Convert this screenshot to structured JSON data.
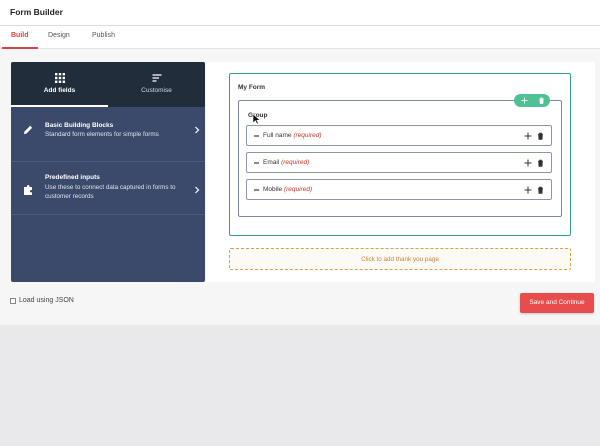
{
  "app": {
    "title": "Form Builder"
  },
  "tabs": [
    {
      "label": "Build",
      "active": true
    },
    {
      "label": "Design",
      "active": false
    },
    {
      "label": "Publish",
      "active": false
    }
  ],
  "sidebar": {
    "tabs": [
      {
        "label": "Add fields",
        "icon": "grid-icon",
        "active": true
      },
      {
        "label": "Customise",
        "icon": "sliders-icon",
        "active": false
      }
    ],
    "items": [
      {
        "title": "Basic Building Blocks",
        "description": "Standard form elements for simple forms",
        "icon": "pencil-icon"
      },
      {
        "title": "Predefined inputs",
        "description": "Use these to connect data captured in forms to customer records",
        "icon": "puzzle-icon"
      }
    ]
  },
  "form": {
    "title": "My Form",
    "group": {
      "title": "Group",
      "fields": [
        {
          "label": "Full name",
          "required_text": "(required)"
        },
        {
          "label": "Email",
          "required_text": "(required)"
        },
        {
          "label": "Mobile",
          "required_text": "(required)"
        }
      ]
    },
    "thank_you_text": "Click to add thank you page"
  },
  "footer": {
    "json_checkbox_label": "Load using JSON",
    "json_checked": false,
    "save_label": "Save and Continue"
  },
  "colors": {
    "accent": "#d64545",
    "sidebar": "#3b4a6b",
    "sidebar_header": "#222d3c",
    "form_border": "#2f9d8f",
    "group_tools": "#4fc195",
    "save_button": "#e84c4c",
    "thank_you": "#c7833a"
  }
}
